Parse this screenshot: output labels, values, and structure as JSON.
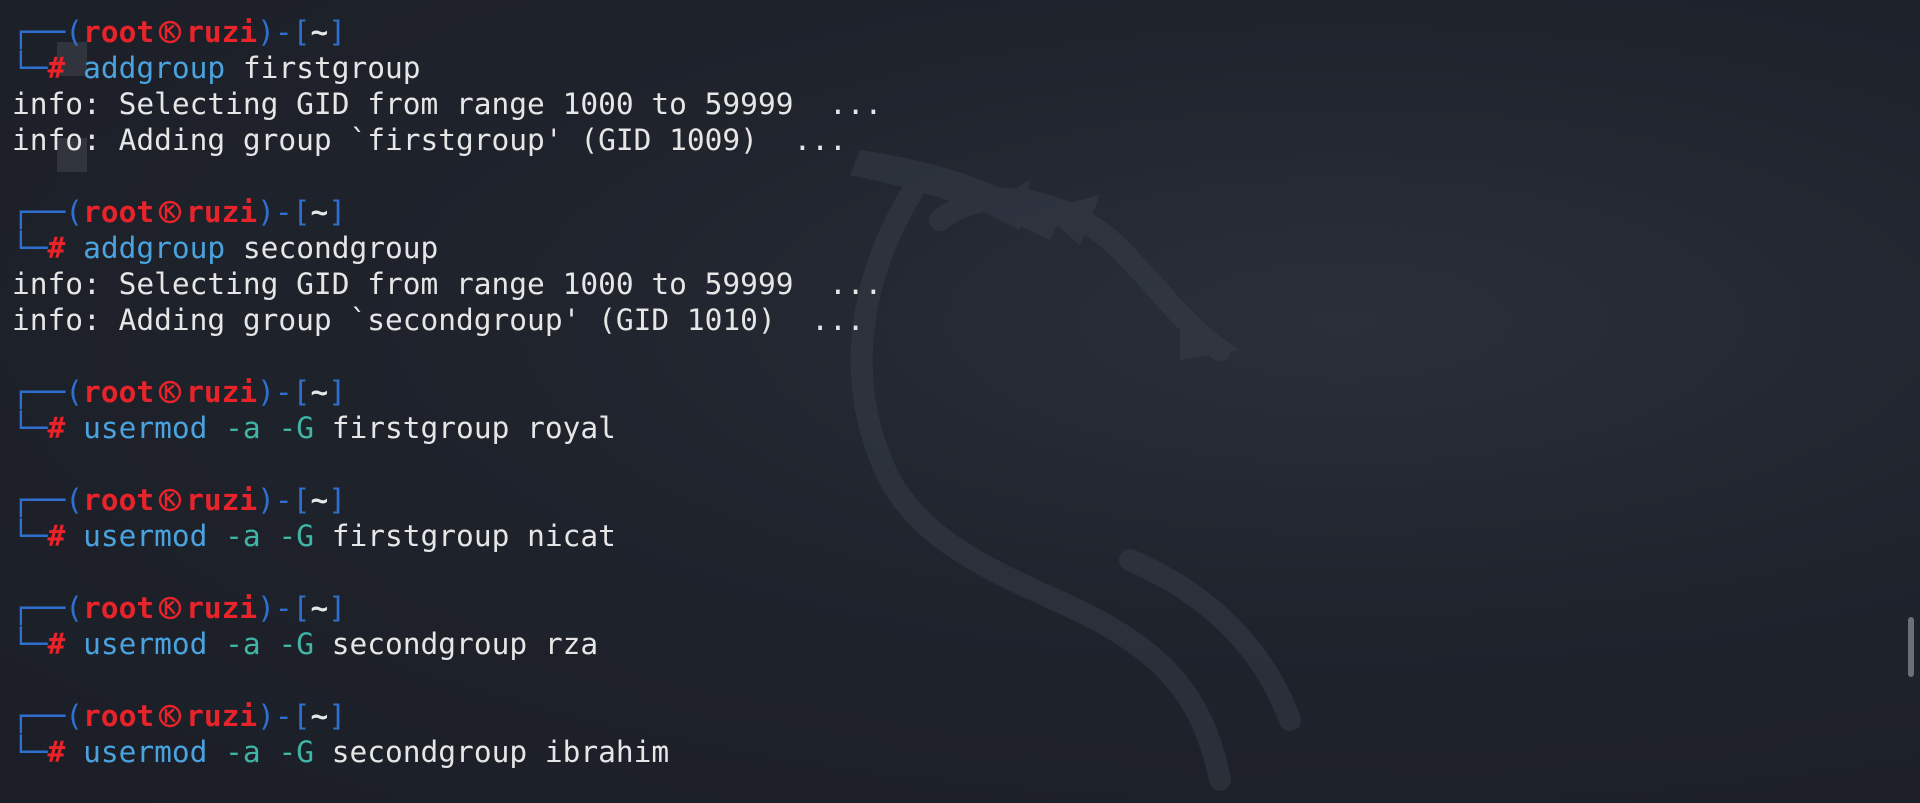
{
  "prompt": {
    "open": "┌──(",
    "user": "root",
    "host": "ruzi",
    "mid": ")-[",
    "dir": "~",
    "close": "]",
    "corner": "└─",
    "hash": "#"
  },
  "colors": {
    "frame": "#2f6fd0",
    "user": "#e8242a",
    "command": "#4aa3df",
    "flag": "#3fb5a5",
    "text": "#e6e6e6",
    "background": "#1f232c"
  },
  "blocks": [
    {
      "command": "addgroup",
      "flags": "",
      "args": "firstgroup",
      "output": [
        "info: Selecting GID from range 1000 to 59999  ...",
        "info: Adding group `firstgroup' (GID 1009)  ..."
      ]
    },
    {
      "command": "addgroup",
      "flags": "",
      "args": "secondgroup",
      "output": [
        "info: Selecting GID from range 1000 to 59999  ...",
        "info: Adding group `secondgroup' (GID 1010)  ..."
      ]
    },
    {
      "command": "usermod",
      "flags": "-a -G",
      "args": "firstgroup royal",
      "output": []
    },
    {
      "command": "usermod",
      "flags": "-a -G",
      "args": "firstgroup nicat",
      "output": []
    },
    {
      "command": "usermod",
      "flags": "-a -G",
      "args": "secondgroup rza",
      "output": []
    },
    {
      "command": "usermod",
      "flags": "-a -G",
      "args": "secondgroup ibrahim",
      "output": []
    }
  ],
  "icons": {
    "separator": "skull-icon",
    "background": "kali-dragon-icon"
  }
}
